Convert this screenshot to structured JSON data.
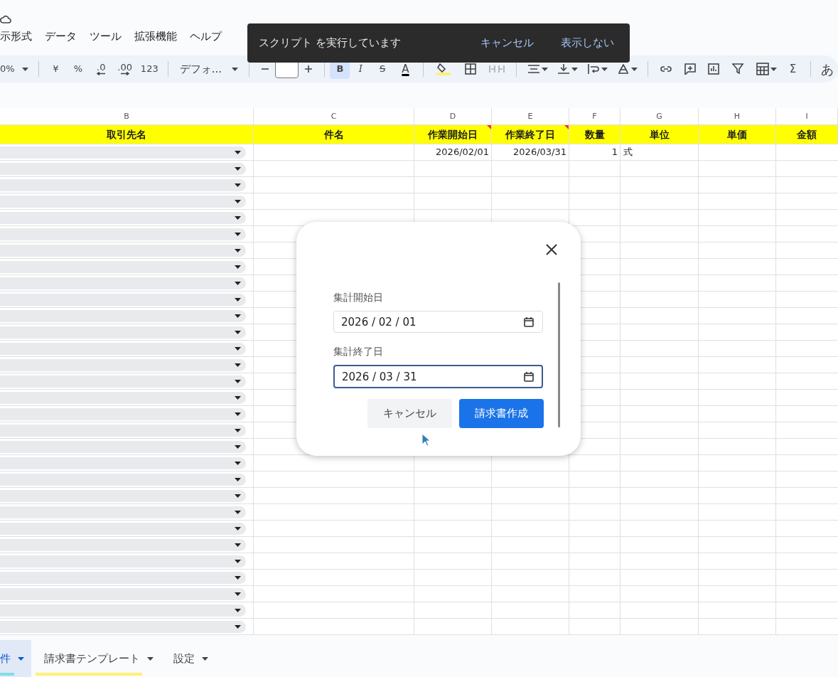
{
  "menu": [
    {
      "label": "示形式"
    },
    {
      "label": "データ"
    },
    {
      "label": "ツール"
    },
    {
      "label": "拡張機能"
    },
    {
      "label": "ヘルプ"
    }
  ],
  "toolbar": {
    "zoom": "0%",
    "currency": "¥",
    "percent": "%",
    "decrease_decimals": ".0",
    "increase_decimals": ".00",
    "number_format": "123",
    "font": "デフォ...",
    "bold": "B",
    "bold_selected": true,
    "italic": "I",
    "strike": "S",
    "text_color": "A",
    "sum": "Σ",
    "input_tools": "あ"
  },
  "toast": {
    "message": "スクリプト を実行しています",
    "actions": [
      "キャンセル",
      "表示しない"
    ]
  },
  "sheet": {
    "columns": [
      {
        "letter": "B",
        "header": "取引先名",
        "note": false
      },
      {
        "letter": "C",
        "header": "件名",
        "note": false
      },
      {
        "letter": "D",
        "header": "作業開始日",
        "note": true
      },
      {
        "letter": "E",
        "header": "作業終了日",
        "note": true
      },
      {
        "letter": "F",
        "header": "数量",
        "note": false
      },
      {
        "letter": "G",
        "header": "単位",
        "note": false
      },
      {
        "letter": "H",
        "header": "単価",
        "note": false
      },
      {
        "letter": "I",
        "header": "金額",
        "note": false
      }
    ],
    "rows": [
      {
        "dropdown": true,
        "start_date": "2026/02/01",
        "end_date": "2026/03/31",
        "quantity": "1",
        "unit": "式"
      },
      {
        "dropdown": true
      },
      {
        "dropdown": true
      },
      {
        "dropdown": true
      },
      {
        "dropdown": true
      },
      {
        "dropdown": true
      },
      {
        "dropdown": true
      },
      {
        "dropdown": true
      },
      {
        "dropdown": true
      },
      {
        "dropdown": true
      },
      {
        "dropdown": true
      },
      {
        "dropdown": true
      },
      {
        "dropdown": true
      },
      {
        "dropdown": true
      },
      {
        "dropdown": true
      },
      {
        "dropdown": true
      },
      {
        "dropdown": true
      },
      {
        "dropdown": true
      },
      {
        "dropdown": true
      },
      {
        "dropdown": true
      },
      {
        "dropdown": true
      },
      {
        "dropdown": true
      },
      {
        "dropdown": true
      },
      {
        "dropdown": true
      },
      {
        "dropdown": true
      },
      {
        "dropdown": true
      },
      {
        "dropdown": true
      },
      {
        "dropdown": true
      },
      {
        "dropdown": true
      },
      {
        "dropdown": true
      }
    ]
  },
  "dialog": {
    "fields": [
      {
        "label": "集計開始日",
        "value": "2026 / 02 / 01",
        "focused": false
      },
      {
        "label": "集計終了日",
        "value": "2026 / 03 / 31",
        "focused": true
      }
    ],
    "cancel": "キャンセル",
    "submit": "請求書作成"
  },
  "sheet_tabs": [
    {
      "label": "件",
      "selected": true,
      "color": "#80deea"
    },
    {
      "label": "請求書テンプレート",
      "selected": false,
      "color": "#fff176"
    },
    {
      "label": "設定",
      "selected": false
    }
  ]
}
